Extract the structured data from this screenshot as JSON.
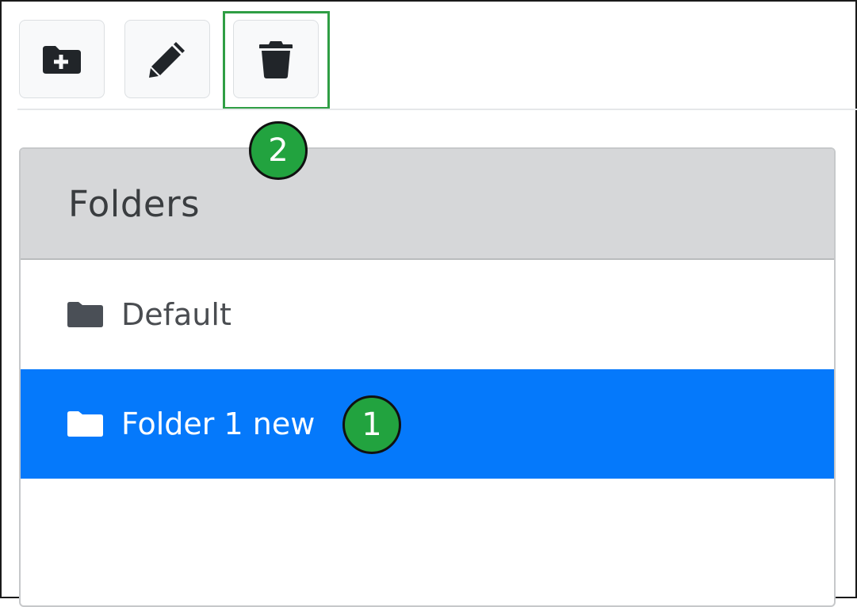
{
  "toolbar": {
    "buttons": [
      {
        "id": "new-folder",
        "icon": "folder-plus-icon"
      },
      {
        "id": "rename-folder",
        "icon": "pencil-icon"
      },
      {
        "id": "delete-folder",
        "icon": "trash-icon"
      }
    ]
  },
  "panel": {
    "title": "Folders",
    "folders": [
      {
        "label": "Default",
        "icon": "folder-icon",
        "selected": false
      },
      {
        "label": "Folder 1 new",
        "icon": "folder-icon",
        "selected": true
      }
    ]
  },
  "annotations": {
    "callout_1": "1",
    "callout_2": "2",
    "highlight_color": "#2f9e44",
    "callout_color": "#22a33f"
  },
  "colors": {
    "selected_row": "#0579fb",
    "header_bg": "#d6d7d9",
    "icon_dark": "#212529"
  }
}
